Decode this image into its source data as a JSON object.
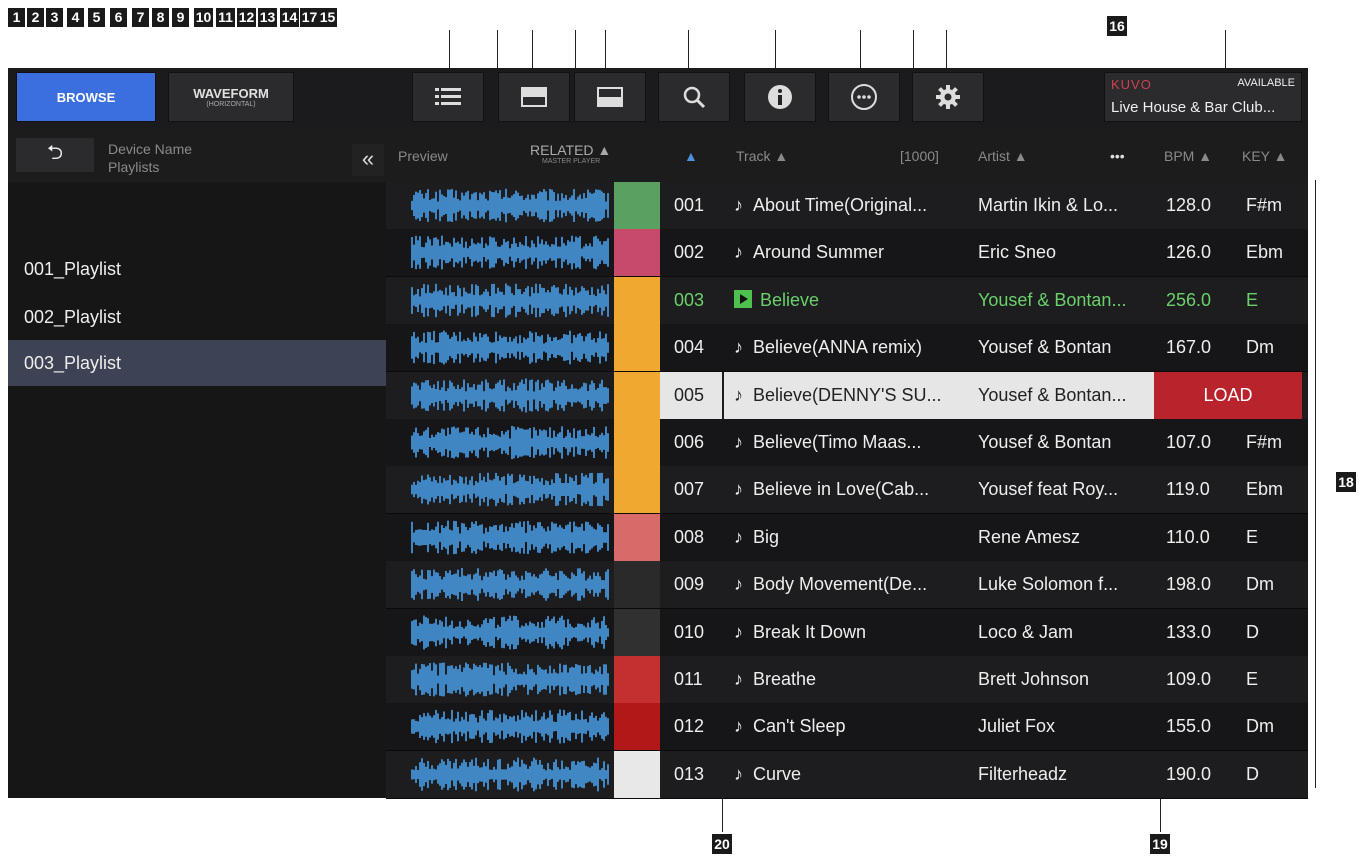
{
  "callouts": {
    "top": [
      "1",
      "2",
      "3",
      "4",
      "5",
      "6",
      "7",
      "8",
      "9",
      "10",
      "11",
      "12",
      "13",
      "14",
      "17",
      "15"
    ],
    "n16": "16",
    "n18": "18",
    "n19": "19",
    "n20": "20"
  },
  "topbar": {
    "browse_label": "BROWSE",
    "waveform_label": "WAVEFORM",
    "waveform_sub": "(HORIZONTAL)",
    "kuvo_brand": "KUVO",
    "kuvo_status": "AVAILABLE",
    "kuvo_venue": "Live House & Bar Club..."
  },
  "sidebar": {
    "back_icon": "⮌",
    "device_name": "Device Name",
    "device_sub": "Playlists",
    "collapse_icon": "«",
    "playlists": [
      "001_Playlist",
      "002_Playlist",
      "003_Playlist"
    ]
  },
  "table": {
    "headers": {
      "preview": "Preview",
      "related": "RELATED",
      "related_sub": "MASTER PLAYER",
      "track": "Track",
      "count": "[1000]",
      "artist": "Artist",
      "more": "•••",
      "bpm": "BPM",
      "key": "KEY"
    },
    "load_label": "LOAD",
    "note_icon": "♪",
    "rows": [
      {
        "num": "001",
        "track": "About Time(Original...",
        "artist": "Martin Ikin & Lo...",
        "bpm": "128.0",
        "key": "F#m",
        "art": "#5aa060"
      },
      {
        "num": "002",
        "track": "Around Summer",
        "artist": "Eric Sneo",
        "bpm": "126.0",
        "key": "Ebm",
        "art": "#c84a6a"
      },
      {
        "num": "003",
        "track": "Believe",
        "artist": "Yousef & Bontan...",
        "bpm": "256.0",
        "key": "E",
        "art": "#f0a830"
      },
      {
        "num": "004",
        "track": "Believe(ANNA remix)",
        "artist": "Yousef & Bontan",
        "bpm": "167.0",
        "key": "Dm",
        "art": "#f0a830"
      },
      {
        "num": "005",
        "track": "Believe(DENNY'S SU...",
        "artist": "Yousef & Bontan...",
        "bpm": "",
        "key": "",
        "art": "#f0a830"
      },
      {
        "num": "006",
        "track": "Believe(Timo Maas...",
        "artist": "Yousef & Bontan",
        "bpm": "107.0",
        "key": "F#m",
        "art": "#f0a830"
      },
      {
        "num": "007",
        "track": "Believe in Love(Cab...",
        "artist": "Yousef feat Roy...",
        "bpm": "119.0",
        "key": "Ebm",
        "art": "#f0a830"
      },
      {
        "num": "008",
        "track": "Big",
        "artist": "Rene Amesz",
        "bpm": "110.0",
        "key": "E",
        "art": "#d86a6a"
      },
      {
        "num": "009",
        "track": "Body Movement(De...",
        "artist": "Luke Solomon f...",
        "bpm": "198.0",
        "key": "Dm",
        "art": "#2a2a2a"
      },
      {
        "num": "010",
        "track": "Break It Down",
        "artist": "Loco & Jam",
        "bpm": "133.0",
        "key": "D",
        "art": "#303030"
      },
      {
        "num": "011",
        "track": "Breathe",
        "artist": "Brett Johnson",
        "bpm": "109.0",
        "key": "E",
        "art": "#c43030"
      },
      {
        "num": "012",
        "track": "Can't Sleep",
        "artist": "Juliet Fox",
        "bpm": "155.0",
        "key": "Dm",
        "art": "#b21818"
      },
      {
        "num": "013",
        "track": "Curve",
        "artist": "Filterheadz",
        "bpm": "190.0",
        "key": "D",
        "art": "#e8e8e8"
      }
    ]
  }
}
